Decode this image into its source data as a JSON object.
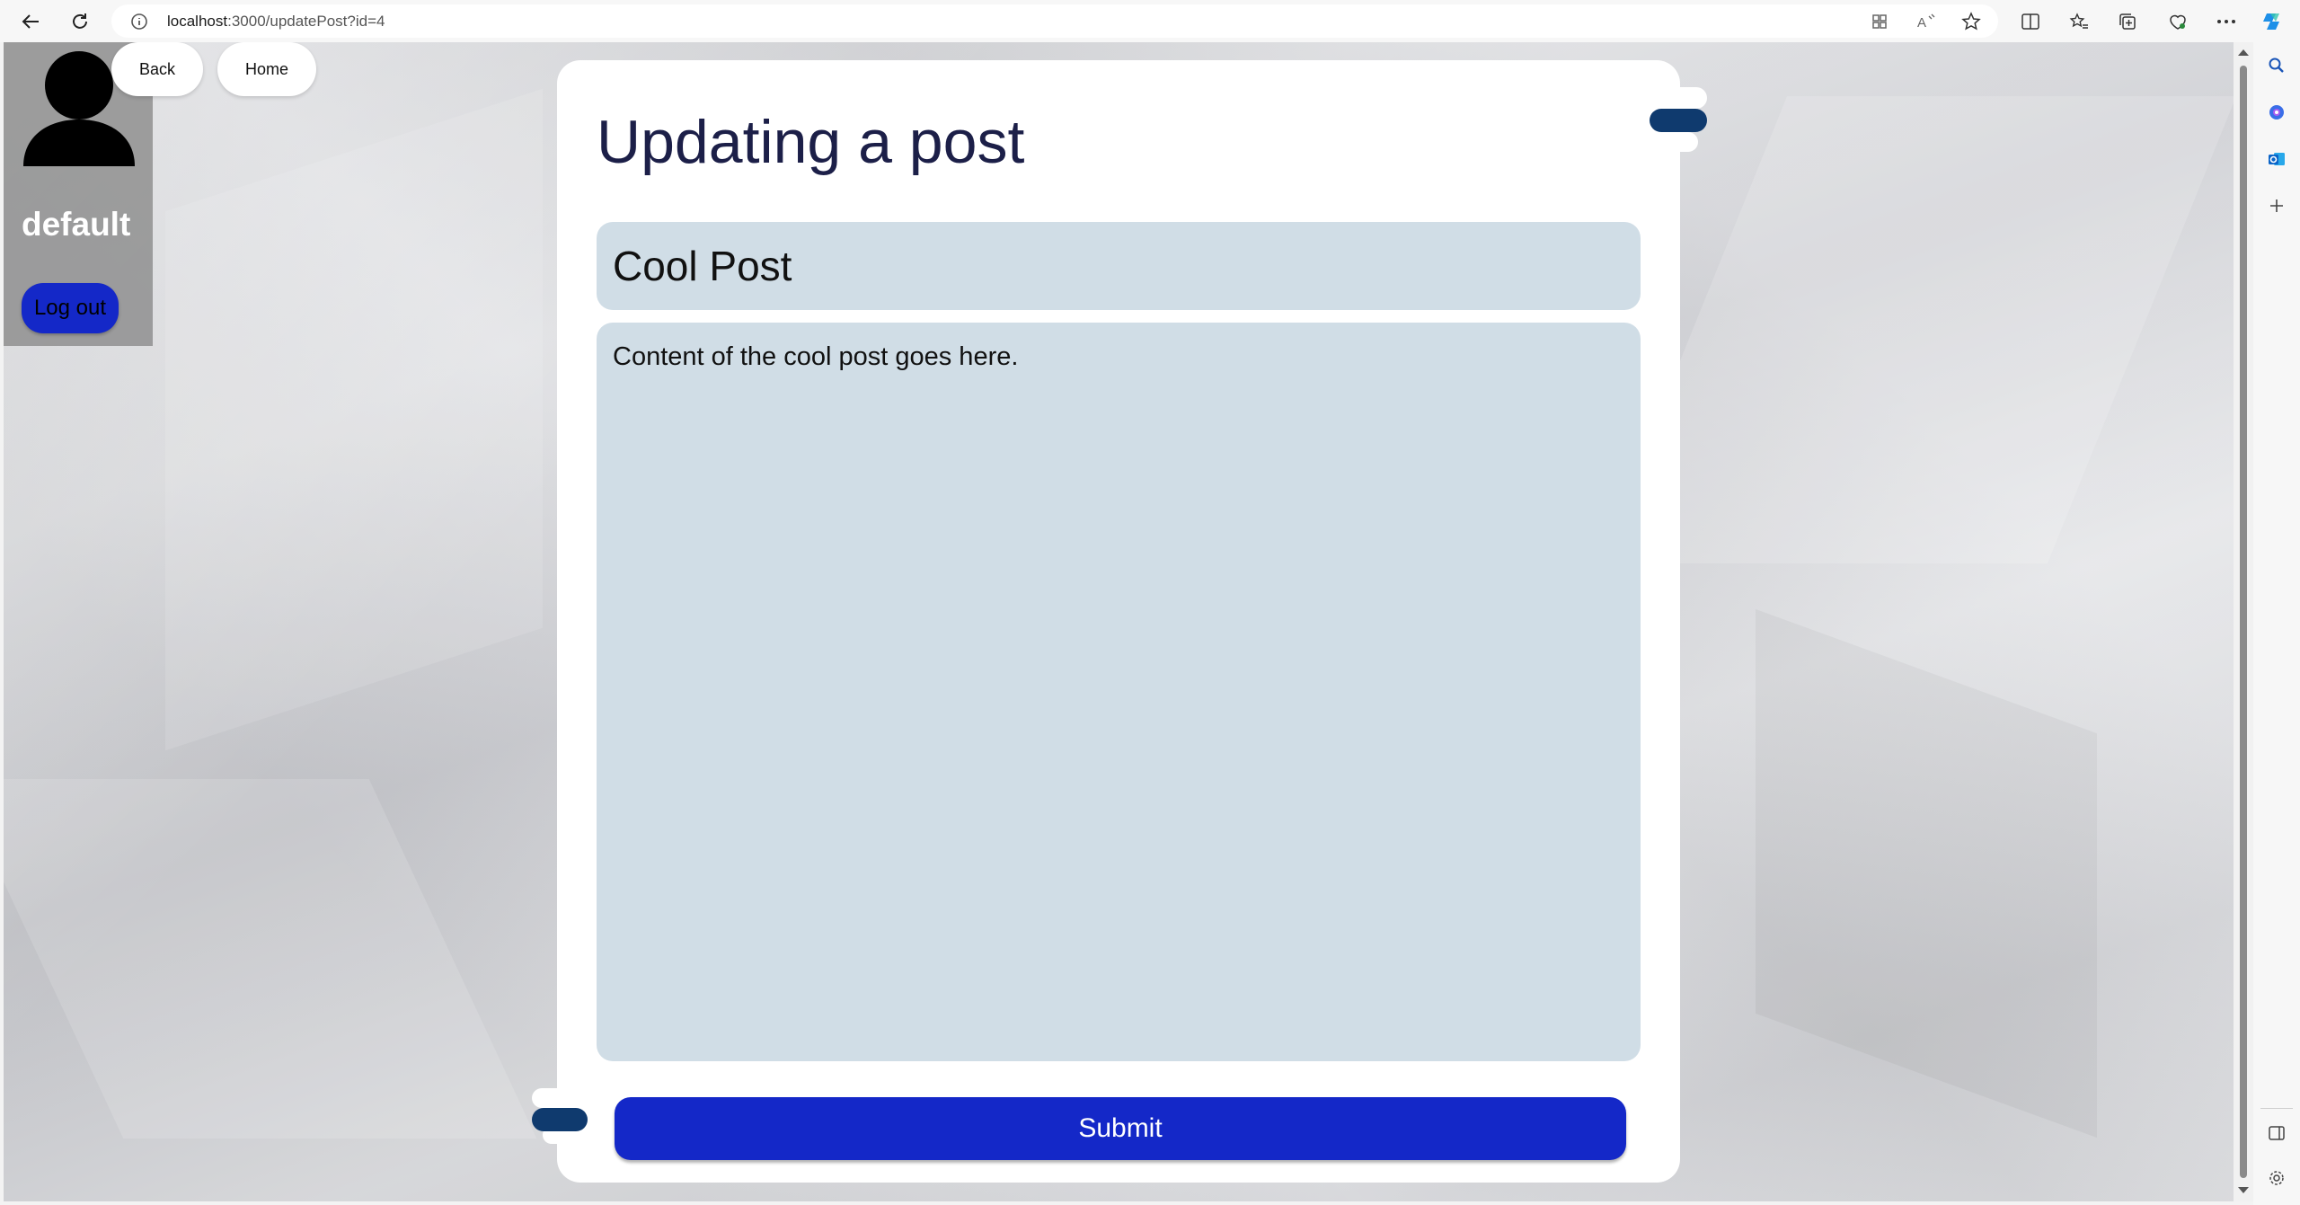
{
  "browser": {
    "url_host": "localhost",
    "url_rest": ":3000/updatePost?id=4"
  },
  "user_panel": {
    "username": "default",
    "logout_label": "Log out"
  },
  "nav": {
    "back_label": "Back",
    "home_label": "Home"
  },
  "form": {
    "heading": "Updating a post",
    "title_value": "Cool Post",
    "content_value": "Content of the cool post goes here.",
    "submit_label": "Submit"
  },
  "colors": {
    "accent_blue": "#1428c8",
    "heading_navy": "#1c1f48",
    "input_bg": "#d0dde6",
    "deco_navy": "#0f3a6e"
  }
}
